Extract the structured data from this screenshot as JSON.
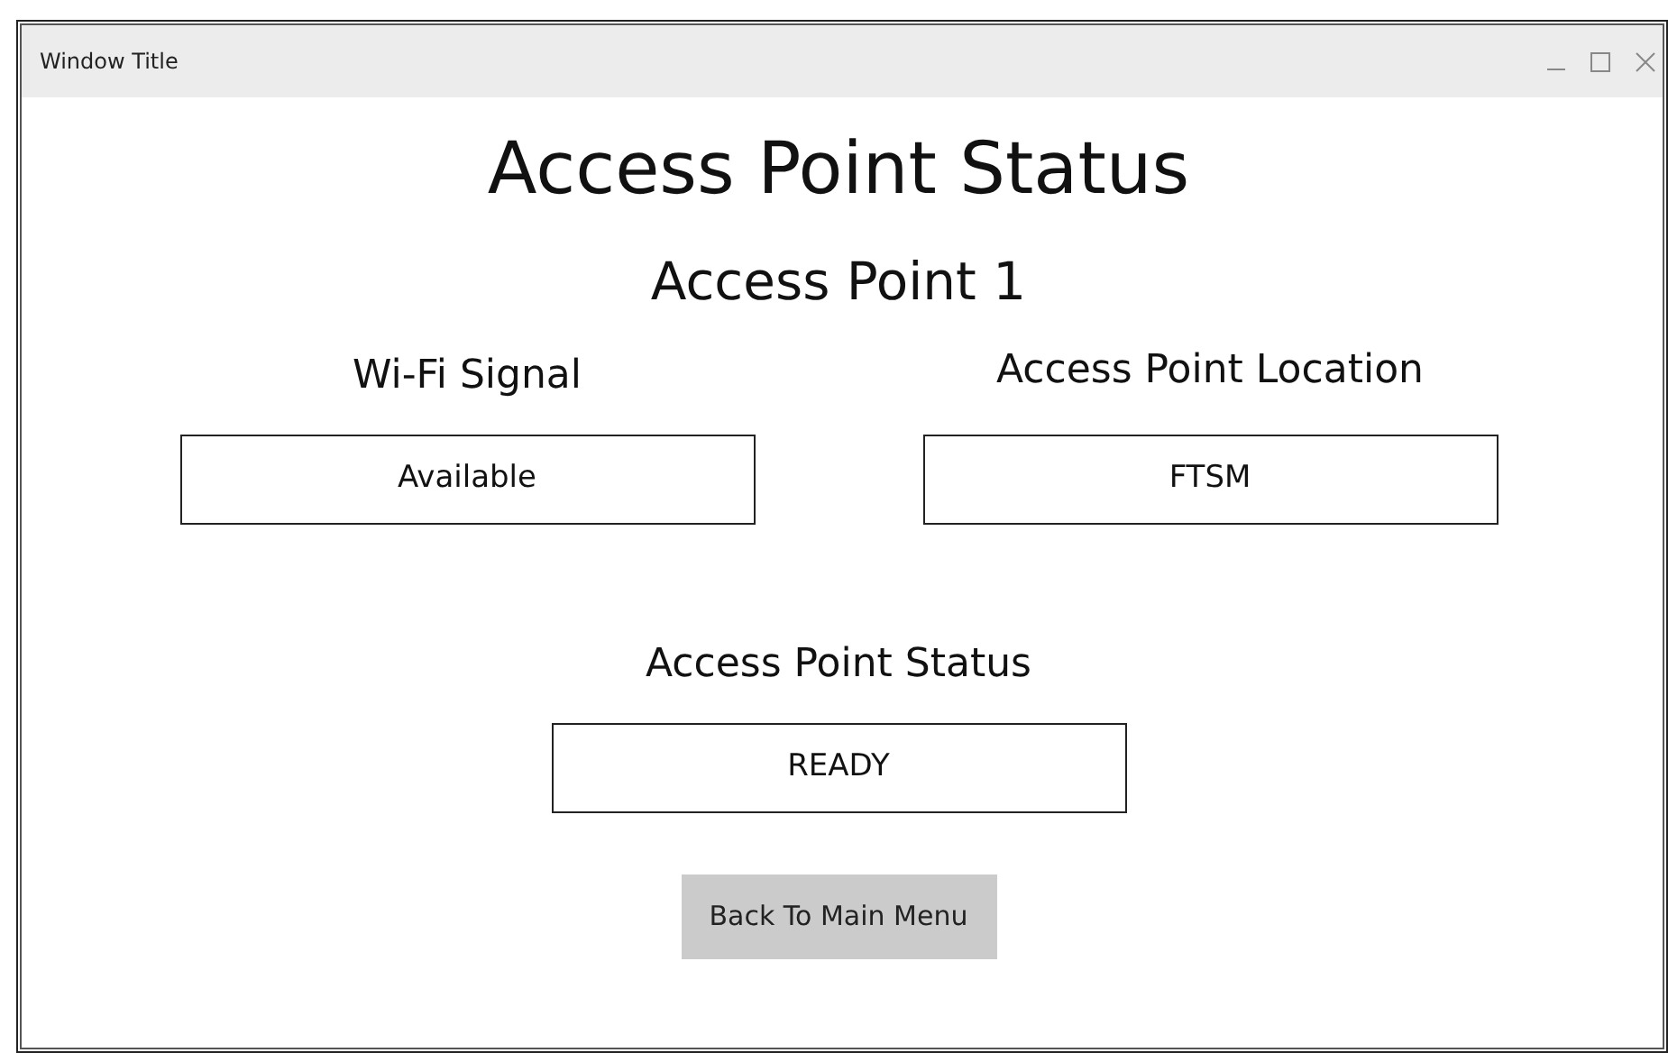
{
  "window": {
    "title": "Window Title"
  },
  "heading": "Access Point Status",
  "subheading": "Access Point 1",
  "fields": [
    {
      "label": "Wi-Fi Signal",
      "value": "Available"
    },
    {
      "label": "Access Point Location",
      "value": "FTSM"
    },
    {
      "label": "Access Point Status",
      "value": "READY"
    }
  ],
  "buttons": [
    "Back To Main Menu"
  ]
}
